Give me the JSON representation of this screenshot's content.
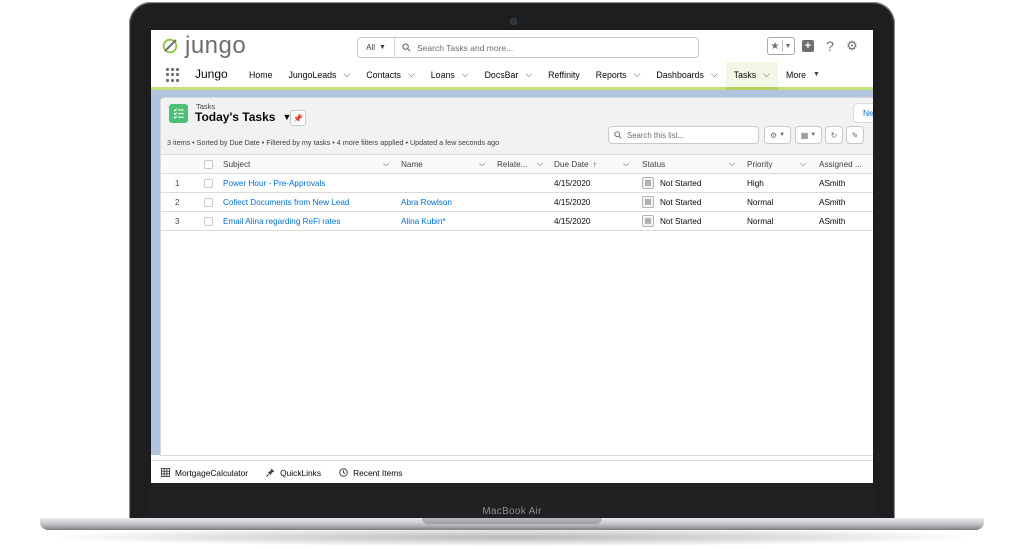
{
  "device": {
    "label": "MacBook Air"
  },
  "brand": {
    "logo_text": "jungo",
    "app_name": "Jungo",
    "accent": "#c5e17a",
    "link_color": "#0070d2"
  },
  "search": {
    "scope": "All",
    "placeholder": "Search Tasks and more..."
  },
  "nav": {
    "home": "Home",
    "jungoleads": "JungoLeads",
    "contacts": "Contacts",
    "loans": "Loans",
    "docsbar": "DocsBar",
    "reffinity": "Reffinity",
    "reports": "Reports",
    "dashboards": "Dashboards",
    "tasks": "Tasks",
    "more": "More"
  },
  "list": {
    "object_label": "Tasks",
    "title": "Today's Tasks",
    "new_label": "Ne",
    "info": "3 items • Sorted by Due Date • Filtered by my tasks • 4 more filters applied • Updated a few seconds ago",
    "search_placeholder": "Search this list..."
  },
  "table": {
    "headers": {
      "subject": "Subject",
      "name": "Name",
      "related": "Relate...",
      "due_date": "Due Date",
      "status": "Status",
      "priority": "Priority",
      "assigned": "Assigned ..."
    },
    "sort_indicator": "↑",
    "rows": [
      {
        "num": "1",
        "subject": "Power Hour - Pre-Approvals",
        "name": "",
        "related": "",
        "due": "4/15/2020",
        "status": "Not Started",
        "priority": "High",
        "assigned": "ASmith"
      },
      {
        "num": "2",
        "subject": "Collect Documents from New Lead",
        "name": "Abra Rowlson",
        "related": "",
        "due": "4/15/2020",
        "status": "Not Started",
        "priority": "Normal",
        "assigned": "ASmith"
      },
      {
        "num": "3",
        "subject": "Email Alina regarding ReFi rates",
        "name": "Alina Kubin*",
        "related": "",
        "due": "4/15/2020",
        "status": "Not Started",
        "priority": "Normal",
        "assigned": "ASmith"
      }
    ]
  },
  "utility": {
    "mortgage": "MortgageCalculator",
    "quicklinks": "QuickLinks",
    "recent": "Recent Items"
  }
}
